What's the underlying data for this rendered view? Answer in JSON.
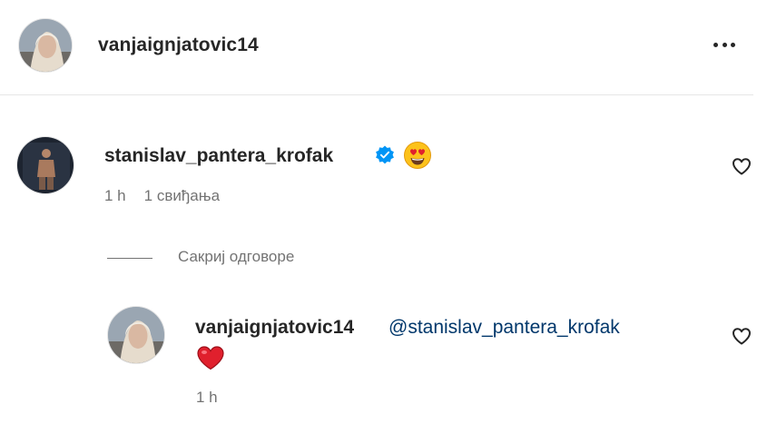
{
  "post": {
    "author_username": "vanjaignjatovic14"
  },
  "comment": {
    "username": "stanislav_pantera_krofak",
    "time": "1 h",
    "likes": "1 свиђања"
  },
  "replies_toggle": {
    "label": "Сакриј одговоре"
  },
  "reply": {
    "username": "vanjaignjatovic14",
    "mention": "@stanislav_pantera_krofak",
    "time": "1 h"
  },
  "icons": {
    "more": "more-horizontal-icon",
    "verified": "verified-badge-icon",
    "heart_eyes": "heart-eyes-emoji-icon",
    "red_heart": "red-heart-emoji-icon",
    "like": "heart-outline-icon"
  },
  "colors": {
    "text": "#262626",
    "muted": "#737373",
    "link": "#00376b",
    "verified": "#0095f6",
    "red_heart": "#e0202d"
  }
}
